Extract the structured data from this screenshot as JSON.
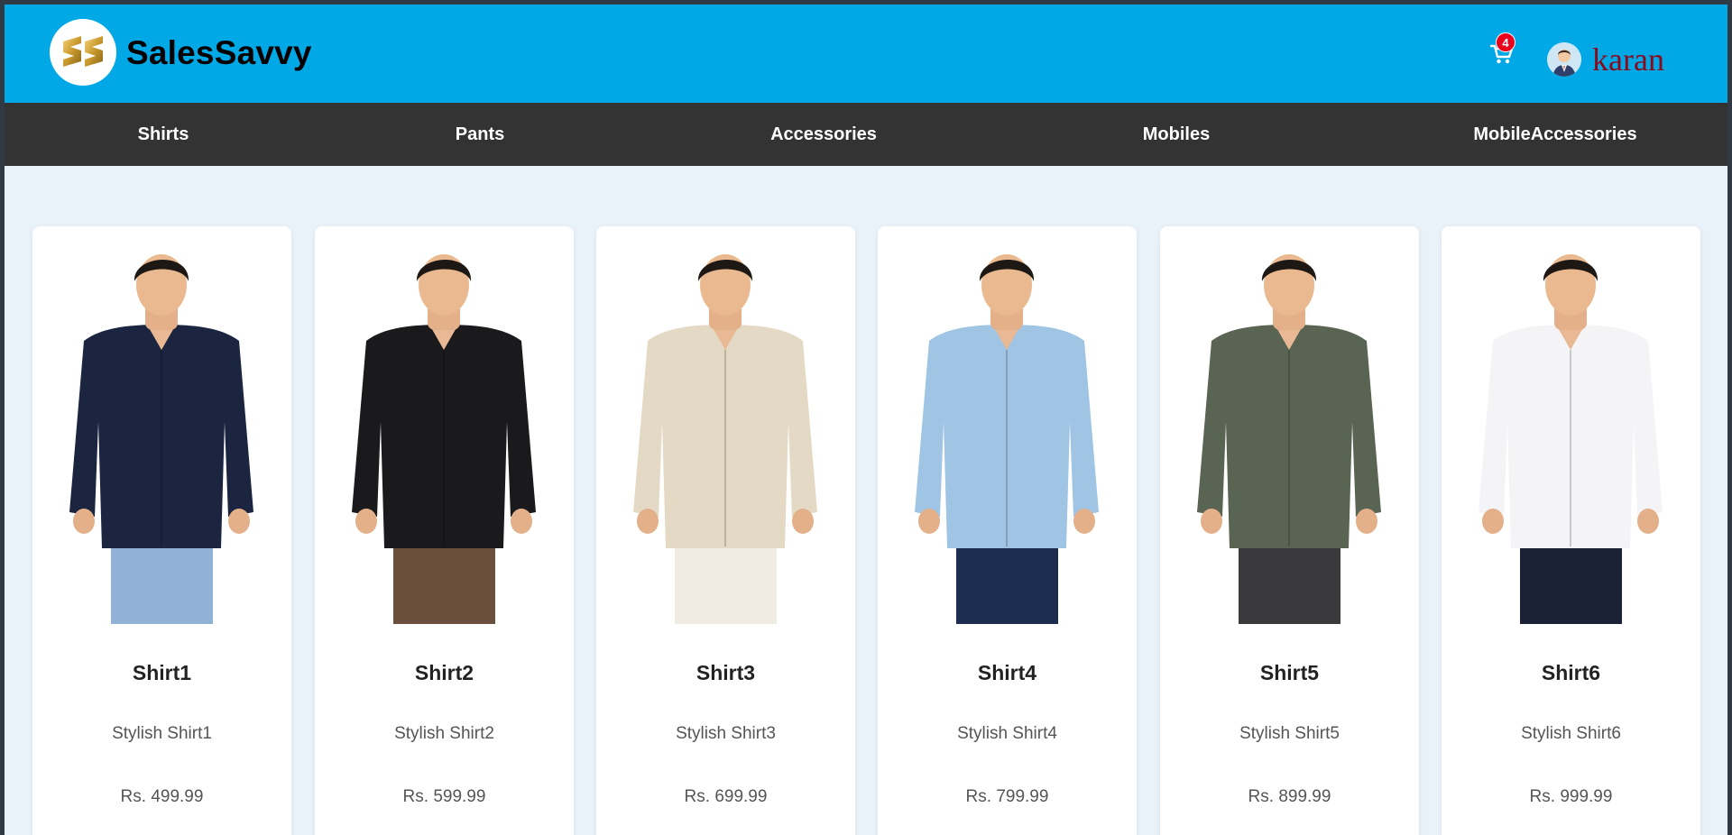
{
  "header": {
    "brand": "SalesSavvy",
    "logo_text": "SS",
    "cart_count": "4",
    "username": "karan"
  },
  "nav": {
    "items": [
      {
        "label": "Shirts"
      },
      {
        "label": "Pants"
      },
      {
        "label": "Accessories"
      },
      {
        "label": "Mobiles"
      },
      {
        "label": "MobileAccessories"
      }
    ]
  },
  "products": [
    {
      "name": "Shirt1",
      "description": "Stylish Shirt1",
      "price": "Rs. 499.99",
      "shirt_color": "#1c2540",
      "pants_color": "#8fb2d6"
    },
    {
      "name": "Shirt2",
      "description": "Stylish Shirt2",
      "price": "Rs. 599.99",
      "shirt_color": "#1a1a1d",
      "pants_color": "#6b4f3d"
    },
    {
      "name": "Shirt3",
      "description": "Stylish Shirt3",
      "price": "Rs. 699.99",
      "shirt_color": "#e4d9c4",
      "pants_color": "#f0ece4"
    },
    {
      "name": "Shirt4",
      "description": "Stylish Shirt4",
      "price": "Rs. 799.99",
      "shirt_color": "#9fc4e4",
      "pants_color": "#1d2d52"
    },
    {
      "name": "Shirt5",
      "description": "Stylish Shirt5",
      "price": "Rs. 899.99",
      "shirt_color": "#5a6452",
      "pants_color": "#3a3a3c"
    },
    {
      "name": "Shirt6",
      "description": "Stylish Shirt6",
      "price": "Rs. 999.99",
      "shirt_color": "#f4f4f6",
      "pants_color": "#1b2238"
    }
  ],
  "colors": {
    "header_bg": "#00a8e6",
    "nav_bg": "#333333",
    "page_bg": "#e9f1f9",
    "badge": "#e8001c",
    "username": "#8b0a1a"
  }
}
